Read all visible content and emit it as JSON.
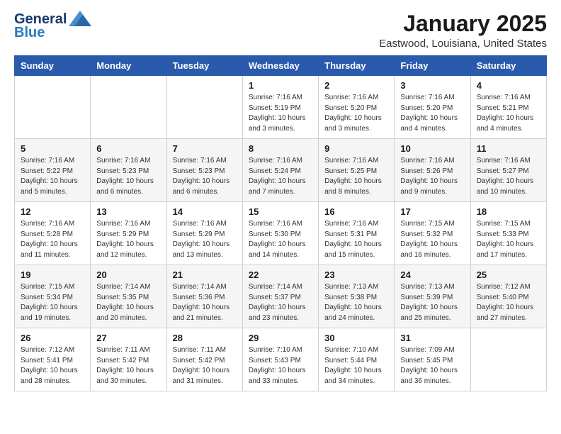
{
  "header": {
    "logo_line1": "General",
    "logo_line2": "Blue",
    "main_title": "January 2025",
    "subtitle": "Eastwood, Louisiana, United States"
  },
  "calendar": {
    "days_of_week": [
      "Sunday",
      "Monday",
      "Tuesday",
      "Wednesday",
      "Thursday",
      "Friday",
      "Saturday"
    ],
    "weeks": [
      [
        {
          "day": "",
          "info": ""
        },
        {
          "day": "",
          "info": ""
        },
        {
          "day": "",
          "info": ""
        },
        {
          "day": "1",
          "info": "Sunrise: 7:16 AM\nSunset: 5:19 PM\nDaylight: 10 hours\nand 3 minutes."
        },
        {
          "day": "2",
          "info": "Sunrise: 7:16 AM\nSunset: 5:20 PM\nDaylight: 10 hours\nand 3 minutes."
        },
        {
          "day": "3",
          "info": "Sunrise: 7:16 AM\nSunset: 5:20 PM\nDaylight: 10 hours\nand 4 minutes."
        },
        {
          "day": "4",
          "info": "Sunrise: 7:16 AM\nSunset: 5:21 PM\nDaylight: 10 hours\nand 4 minutes."
        }
      ],
      [
        {
          "day": "5",
          "info": "Sunrise: 7:16 AM\nSunset: 5:22 PM\nDaylight: 10 hours\nand 5 minutes."
        },
        {
          "day": "6",
          "info": "Sunrise: 7:16 AM\nSunset: 5:23 PM\nDaylight: 10 hours\nand 6 minutes."
        },
        {
          "day": "7",
          "info": "Sunrise: 7:16 AM\nSunset: 5:23 PM\nDaylight: 10 hours\nand 6 minutes."
        },
        {
          "day": "8",
          "info": "Sunrise: 7:16 AM\nSunset: 5:24 PM\nDaylight: 10 hours\nand 7 minutes."
        },
        {
          "day": "9",
          "info": "Sunrise: 7:16 AM\nSunset: 5:25 PM\nDaylight: 10 hours\nand 8 minutes."
        },
        {
          "day": "10",
          "info": "Sunrise: 7:16 AM\nSunset: 5:26 PM\nDaylight: 10 hours\nand 9 minutes."
        },
        {
          "day": "11",
          "info": "Sunrise: 7:16 AM\nSunset: 5:27 PM\nDaylight: 10 hours\nand 10 minutes."
        }
      ],
      [
        {
          "day": "12",
          "info": "Sunrise: 7:16 AM\nSunset: 5:28 PM\nDaylight: 10 hours\nand 11 minutes."
        },
        {
          "day": "13",
          "info": "Sunrise: 7:16 AM\nSunset: 5:29 PM\nDaylight: 10 hours\nand 12 minutes."
        },
        {
          "day": "14",
          "info": "Sunrise: 7:16 AM\nSunset: 5:29 PM\nDaylight: 10 hours\nand 13 minutes."
        },
        {
          "day": "15",
          "info": "Sunrise: 7:16 AM\nSunset: 5:30 PM\nDaylight: 10 hours\nand 14 minutes."
        },
        {
          "day": "16",
          "info": "Sunrise: 7:16 AM\nSunset: 5:31 PM\nDaylight: 10 hours\nand 15 minutes."
        },
        {
          "day": "17",
          "info": "Sunrise: 7:15 AM\nSunset: 5:32 PM\nDaylight: 10 hours\nand 16 minutes."
        },
        {
          "day": "18",
          "info": "Sunrise: 7:15 AM\nSunset: 5:33 PM\nDaylight: 10 hours\nand 17 minutes."
        }
      ],
      [
        {
          "day": "19",
          "info": "Sunrise: 7:15 AM\nSunset: 5:34 PM\nDaylight: 10 hours\nand 19 minutes."
        },
        {
          "day": "20",
          "info": "Sunrise: 7:14 AM\nSunset: 5:35 PM\nDaylight: 10 hours\nand 20 minutes."
        },
        {
          "day": "21",
          "info": "Sunrise: 7:14 AM\nSunset: 5:36 PM\nDaylight: 10 hours\nand 21 minutes."
        },
        {
          "day": "22",
          "info": "Sunrise: 7:14 AM\nSunset: 5:37 PM\nDaylight: 10 hours\nand 23 minutes."
        },
        {
          "day": "23",
          "info": "Sunrise: 7:13 AM\nSunset: 5:38 PM\nDaylight: 10 hours\nand 24 minutes."
        },
        {
          "day": "24",
          "info": "Sunrise: 7:13 AM\nSunset: 5:39 PM\nDaylight: 10 hours\nand 25 minutes."
        },
        {
          "day": "25",
          "info": "Sunrise: 7:12 AM\nSunset: 5:40 PM\nDaylight: 10 hours\nand 27 minutes."
        }
      ],
      [
        {
          "day": "26",
          "info": "Sunrise: 7:12 AM\nSunset: 5:41 PM\nDaylight: 10 hours\nand 28 minutes."
        },
        {
          "day": "27",
          "info": "Sunrise: 7:11 AM\nSunset: 5:42 PM\nDaylight: 10 hours\nand 30 minutes."
        },
        {
          "day": "28",
          "info": "Sunrise: 7:11 AM\nSunset: 5:42 PM\nDaylight: 10 hours\nand 31 minutes."
        },
        {
          "day": "29",
          "info": "Sunrise: 7:10 AM\nSunset: 5:43 PM\nDaylight: 10 hours\nand 33 minutes."
        },
        {
          "day": "30",
          "info": "Sunrise: 7:10 AM\nSunset: 5:44 PM\nDaylight: 10 hours\nand 34 minutes."
        },
        {
          "day": "31",
          "info": "Sunrise: 7:09 AM\nSunset: 5:45 PM\nDaylight: 10 hours\nand 36 minutes."
        },
        {
          "day": "",
          "info": ""
        }
      ]
    ]
  }
}
